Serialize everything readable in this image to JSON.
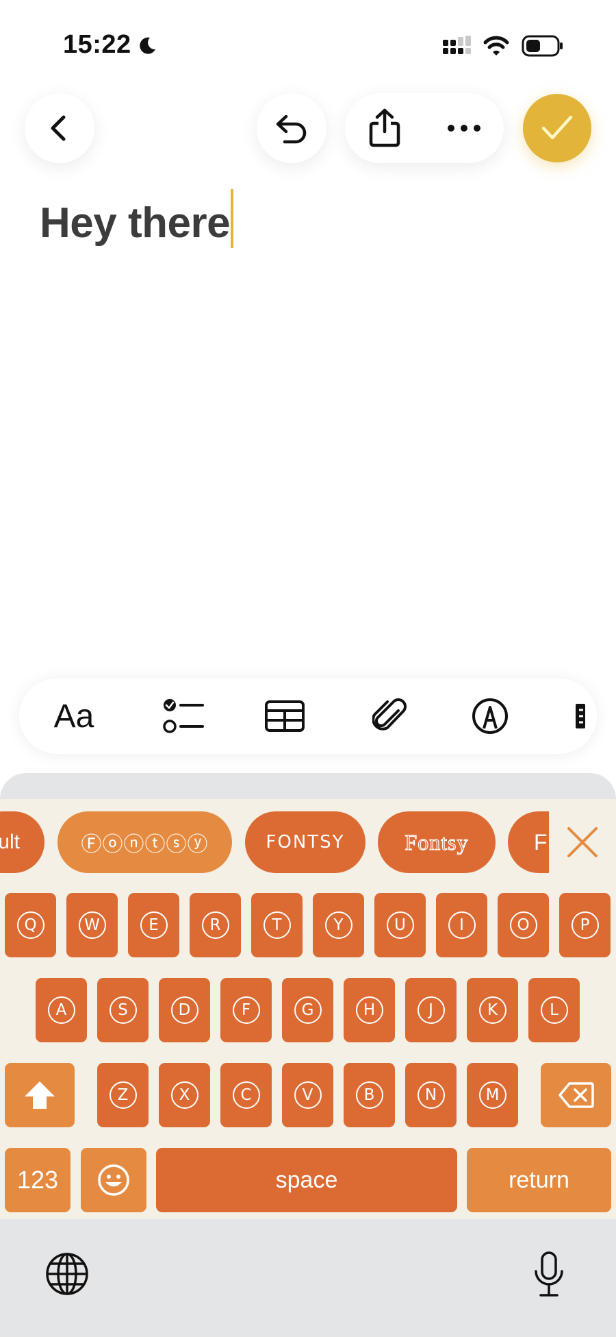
{
  "status_bar": {
    "time": "15:22",
    "icons": [
      "moon-icon",
      "cellular-signal-icon",
      "wifi-icon",
      "battery-icon"
    ]
  },
  "toolbar": {
    "icons": [
      "back-chevron-icon",
      "undo-icon",
      "share-icon",
      "more-icon",
      "checkmark-icon"
    ],
    "accent_color": "#e2b43a"
  },
  "note": {
    "text": "Hey there"
  },
  "format_bar": {
    "text_style_label": "Aa",
    "icons": [
      "checklist-icon",
      "table-icon",
      "attachment-icon",
      "markup-icon",
      "more-formatting-icon"
    ]
  },
  "font_chips": [
    {
      "label": "ult",
      "style": "partial"
    },
    {
      "label": "Ⓕⓞⓝⓣⓢⓨ",
      "style": "circled"
    },
    {
      "label": "FONTSY",
      "style": "caps"
    },
    {
      "label": "Fontsy",
      "style": "outline-serif"
    },
    {
      "label": "F",
      "style": "partial"
    }
  ],
  "keyboard": {
    "row1": [
      "Q",
      "W",
      "E",
      "R",
      "T",
      "Y",
      "U",
      "I",
      "O",
      "P"
    ],
    "row2": [
      "A",
      "S",
      "D",
      "F",
      "G",
      "H",
      "J",
      "K",
      "L"
    ],
    "row3": [
      "Z",
      "X",
      "C",
      "V",
      "B",
      "N",
      "M"
    ],
    "numbers_label": "123",
    "space_label": "space",
    "return_label": "return",
    "key_color": "#dc6a33",
    "accent_key_color": "#e48b41",
    "background_color": "#f5f0e6"
  },
  "bottom_bar": {
    "icons": [
      "globe-icon",
      "microphone-icon"
    ]
  }
}
